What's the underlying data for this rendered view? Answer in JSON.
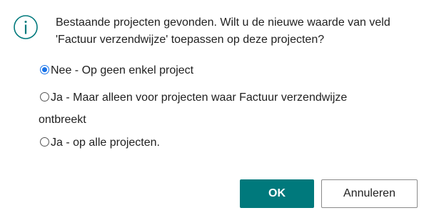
{
  "dialog": {
    "icon": "info-icon",
    "message_line1": "Bestaande projecten gevonden. Wilt u de nieuwe waarde van veld",
    "message_line2": "'Factuur verzendwijze' toepassen op deze projecten?"
  },
  "options": [
    {
      "label": "Nee - Op geen enkel project",
      "selected": true
    },
    {
      "label_line1": "Ja - Maar alleen voor projecten waar Factuur verzendwijze",
      "label_line2": "ontbreekt",
      "selected": false
    },
    {
      "label": "Ja - op alle projecten.",
      "selected": false
    }
  ],
  "buttons": {
    "ok_label": "OK",
    "cancel_label": "Annuleren"
  },
  "colors": {
    "accent": "#00797c",
    "icon": "#00797c",
    "radio_selected": "#1a73e8"
  }
}
